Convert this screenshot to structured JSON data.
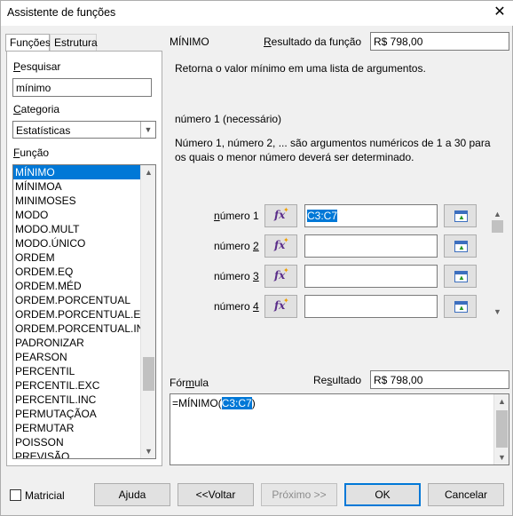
{
  "window": {
    "title": "Assistente de funções",
    "close_glyph": "✕"
  },
  "tabs": [
    {
      "label": "Funções",
      "active": true
    },
    {
      "label": "Estrutura",
      "active": false
    }
  ],
  "left": {
    "search_label": "Pesquisar",
    "search_value": "mínimo",
    "category_label": "Categoria",
    "category_value": "Estatísticas",
    "function_label": "Função",
    "functions": [
      "MÍNIMO",
      "MÍNIMOA",
      "MINIMOSES",
      "MODO",
      "MODO.MULT",
      "MODO.ÚNICO",
      "ORDEM",
      "ORDEM.EQ",
      "ORDEM.MÉD",
      "ORDEM.PORCENTUAL",
      "ORDEM.PORCENTUAL.EXC",
      "ORDEM.PORCENTUAL.INC",
      "PADRONIZAR",
      "PEARSON",
      "PERCENTIL",
      "PERCENTIL.EXC",
      "PERCENTIL.INC",
      "PERMUTAÇÃOA",
      "PERMUTAR",
      "POISSON",
      "PREVISÃO"
    ],
    "selected_index": 0
  },
  "right": {
    "function_name": "MÍNIMO",
    "result_label": "Resultado da função",
    "result_value": "R$ 798,00",
    "description": "Retorna o valor mínimo em uma lista de argumentos.",
    "arg_title": "número 1 (necessário)",
    "arg_description": "Número 1, número 2, ... são argumentos numéricos de 1 a 30 para os quais o menor número deverá ser determinado.",
    "args": [
      {
        "label_prefix": "",
        "label_ul": "n",
        "label_rest": "úmero 1",
        "value": "C3:C7",
        "selected": true
      },
      {
        "label_prefix": "número ",
        "label_ul": "2",
        "label_rest": "",
        "value": "",
        "selected": false
      },
      {
        "label_prefix": "número ",
        "label_ul": "3",
        "label_rest": "",
        "value": "",
        "selected": false
      },
      {
        "label_prefix": "número ",
        "label_ul": "4",
        "label_rest": "",
        "value": "",
        "selected": false
      }
    ],
    "fx_glyph": "fx",
    "formula_label": "Fórmula",
    "formula_result_label": "Resultado",
    "formula_result_value": "R$ 798,00",
    "formula_prefix": "=MÍNIMO(",
    "formula_selected": "C3:C7",
    "formula_suffix": ")"
  },
  "footer": {
    "matricial_label": "Matricial",
    "help_label": "Ajuda",
    "back_label": "<<Voltar",
    "next_label": "Próximo >>",
    "ok_label": "OK",
    "cancel_label": "Cancelar"
  }
}
